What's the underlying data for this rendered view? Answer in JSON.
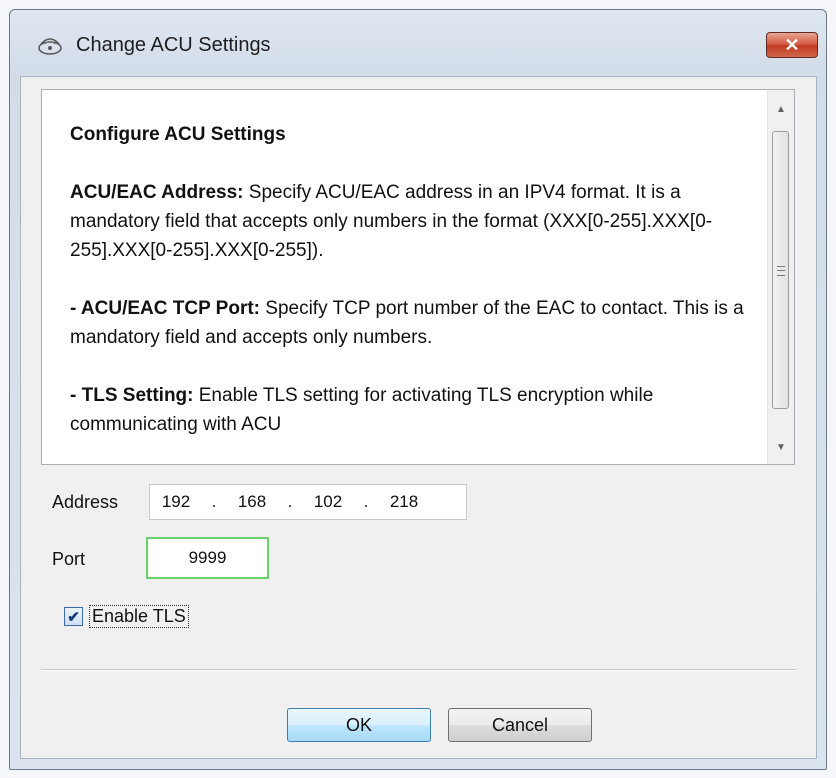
{
  "window": {
    "title": "Change ACU Settings",
    "close_symbol": "✕"
  },
  "help": {
    "heading": "Configure ACU Settings",
    "paragraphs": [
      {
        "label": "ACU/EAC Address:",
        "text": " Specify ACU/EAC address in an IPV4 format. It is a mandatory field that accepts only numbers in the format (XXX[0-255].XXX[0-255].XXX[0-255].XXX[0-255])."
      },
      {
        "label": "- ACU/EAC TCP Port:",
        "text": " Specify TCP port number of the EAC to contact. This is a mandatory field and accepts only numbers."
      },
      {
        "label": "- TLS Setting:",
        "text": " Enable TLS setting for activating TLS encryption while communicating with ACU"
      }
    ]
  },
  "form": {
    "address_label": "Address",
    "address": [
      "192",
      "168",
      "102",
      "218"
    ],
    "address_dot": ".",
    "port_label": "Port",
    "port_value": "9999",
    "tls_label": "Enable TLS",
    "tls_checked_symbol": "✔"
  },
  "buttons": {
    "ok": "OK",
    "cancel": "Cancel"
  },
  "icons": {
    "title_icon": "settings-signal-icon"
  }
}
